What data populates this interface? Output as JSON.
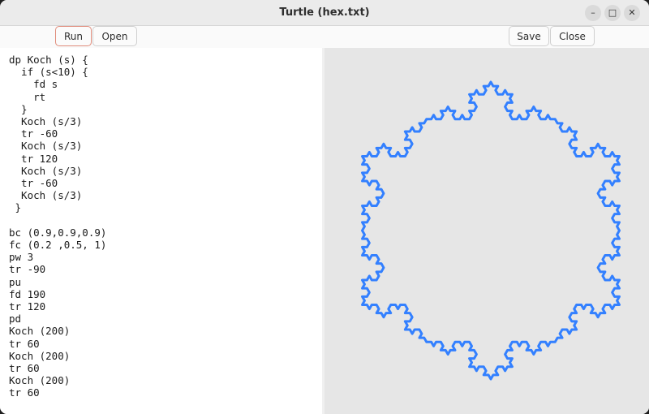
{
  "window": {
    "title": "Turtle (hex.txt)",
    "controls": {
      "minimize": "–",
      "maximize": "□",
      "close": "✕"
    }
  },
  "toolbar": {
    "run_label": "Run",
    "open_label": "Open",
    "save_label": "Save",
    "close_label": "Close"
  },
  "editor": {
    "code": "dp Koch (s) {\n  if (s<10) {\n    fd s\n    rt\n  }\n  Koch (s/3)\n  tr -60\n  Koch (s/3)\n  tr 120\n  Koch (s/3)\n  tr -60\n  Koch (s/3)\n }\n\nbc (0.9,0.9,0.9)\nfc (0.2 ,0.5, 1)\npw 3\ntr -90\npu\nfd 190\ntr 120\npd\nKoch (200)\ntr 60\nKoch (200)\ntr 60\nKoch (200)\ntr 60"
  },
  "canvas": {
    "background_color": "#e6e6e6",
    "stroke_color": "#3380ff",
    "shape": "hexagon-koch-curve"
  }
}
